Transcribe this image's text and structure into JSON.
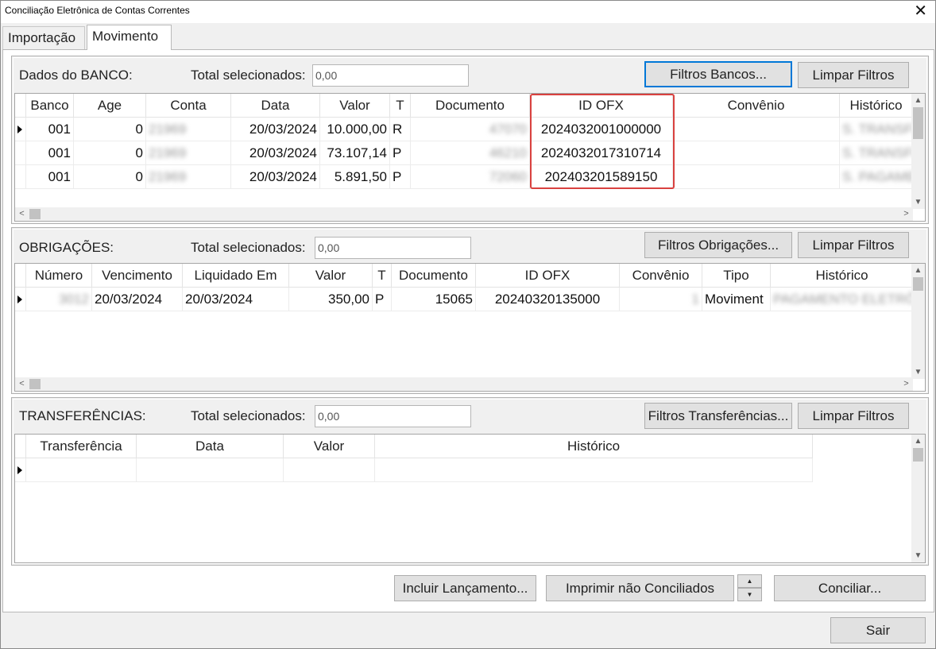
{
  "window": {
    "title": "Conciliação Eletrônica de Contas Correntes",
    "close_glyph": "✕"
  },
  "tabs": [
    {
      "label": "Importação"
    },
    {
      "label": "Movimento"
    }
  ],
  "banco": {
    "label": "Dados do BANCO:",
    "total_label": "Total selecionados:",
    "total_placeholder": "0,00",
    "filter_button": "Filtros Bancos...",
    "clear_button": "Limpar Filtros",
    "columns": [
      "Banco",
      "Age",
      "Conta",
      "Data",
      "Valor",
      "T",
      "Documento",
      "ID OFX",
      "Convênio",
      "Histórico"
    ],
    "rows": [
      {
        "banco": "001",
        "age": "0",
        "conta": "21969",
        "data": "20/03/2024",
        "valor": "10.000,00",
        "t": "R",
        "documento": "47070",
        "id_ofx": "2024032001000000",
        "convenio": "",
        "historico": "S. TRANSFERÊN"
      },
      {
        "banco": "001",
        "age": "0",
        "conta": "21969",
        "data": "20/03/2024",
        "valor": "73.107,14",
        "t": "P",
        "documento": "46210",
        "id_ofx": "2024032017310714",
        "convenio": "",
        "historico": "S. TRANSFERÊN"
      },
      {
        "banco": "001",
        "age": "0",
        "conta": "21969",
        "data": "20/03/2024",
        "valor": "5.891,50",
        "t": "P",
        "documento": "72060",
        "id_ofx": "202403201589150",
        "convenio": "",
        "historico": "S. PAGAMENT"
      }
    ]
  },
  "obrigacoes": {
    "label": "OBRIGAÇÕES:",
    "total_label": "Total selecionados:",
    "total_placeholder": "0,00",
    "filter_button": "Filtros Obrigações...",
    "clear_button": "Limpar Filtros",
    "columns": [
      "Número",
      "Vencimento",
      "Liquidado Em",
      "Valor",
      "T",
      "Documento",
      "ID OFX",
      "Convênio",
      "Tipo",
      "Histórico"
    ],
    "rows": [
      {
        "numero": "3012",
        "vencimento": "20/03/2024",
        "liquidado": "20/03/2024",
        "valor": "350,00",
        "t": "P",
        "documento": "15065",
        "id_ofx": "20240320135000",
        "convenio": "1",
        "tipo": "Moviment",
        "historico": "PAGAMENTO ELETRÔ"
      }
    ]
  },
  "transferencias": {
    "label": "TRANSFERÊNCIAS:",
    "total_label": "Total selecionados:",
    "total_placeholder": "0,00",
    "filter_button": "Filtros Transferências...",
    "clear_button": "Limpar Filtros",
    "columns": [
      "Transferência",
      "Data",
      "Valor",
      "Histórico"
    ]
  },
  "actions": {
    "incluir": "Incluir Lançamento...",
    "imprimir": "Imprimir não Conciliados",
    "spin_up": "▲",
    "spin_down": "▼",
    "conciliar": "Conciliar...",
    "sair": "Sair"
  },
  "scroll_glyphs": {
    "up": "▲",
    "down": "▼",
    "left": "<",
    "right": ">"
  },
  "colors": {
    "highlight": "#d9413f",
    "focus": "#0078d7"
  }
}
